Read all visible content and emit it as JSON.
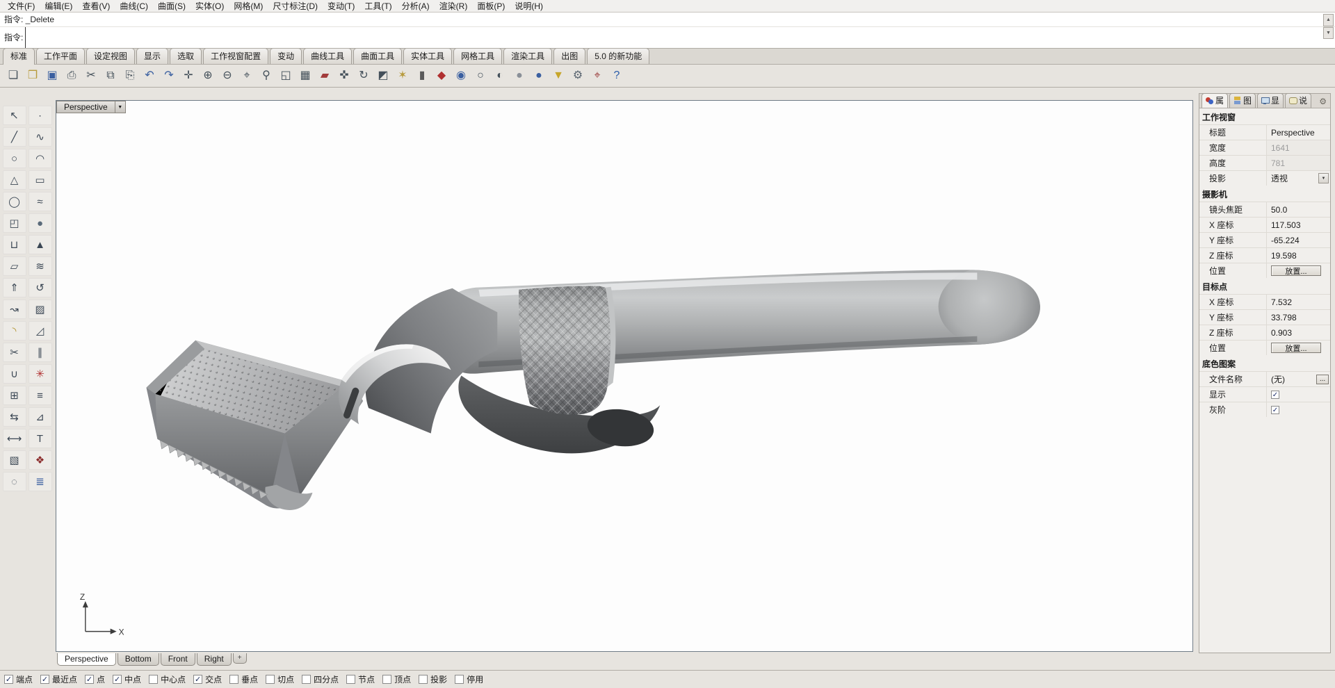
{
  "menu_bar": {
    "items": [
      {
        "name": "menu-file",
        "label": "文件(F)"
      },
      {
        "name": "menu-edit",
        "label": "编辑(E)"
      },
      {
        "name": "menu-view",
        "label": "查看(V)"
      },
      {
        "name": "menu-curve",
        "label": "曲线(C)"
      },
      {
        "name": "menu-surface",
        "label": "曲面(S)"
      },
      {
        "name": "menu-solid",
        "label": "实体(O)"
      },
      {
        "name": "menu-mesh",
        "label": "网格(M)"
      },
      {
        "name": "menu-dimension",
        "label": "尺寸标注(D)"
      },
      {
        "name": "menu-transform",
        "label": "变动(T)"
      },
      {
        "name": "menu-tools",
        "label": "工具(T)"
      },
      {
        "name": "menu-analyze",
        "label": "分析(A)"
      },
      {
        "name": "menu-render",
        "label": "渲染(R)"
      },
      {
        "name": "menu-panels",
        "label": "面板(P)"
      },
      {
        "name": "menu-help",
        "label": "说明(H)"
      }
    ]
  },
  "command": {
    "history": "指令: _Delete",
    "prompt_label": "指令:"
  },
  "toolbar_tabs": {
    "items": [
      {
        "name": "tab-standard",
        "label": "标准",
        "active": true
      },
      {
        "name": "tab-cplane",
        "label": "工作平面"
      },
      {
        "name": "tab-set-view",
        "label": "设定视图"
      },
      {
        "name": "tab-display",
        "label": "显示"
      },
      {
        "name": "tab-select",
        "label": "选取"
      },
      {
        "name": "tab-viewport-layout",
        "label": "工作视窗配置"
      },
      {
        "name": "tab-transform",
        "label": "变动"
      },
      {
        "name": "tab-curve-tools",
        "label": "曲线工具"
      },
      {
        "name": "tab-surface-tools",
        "label": "曲面工具"
      },
      {
        "name": "tab-solid-tools",
        "label": "实体工具"
      },
      {
        "name": "tab-mesh-tools",
        "label": "网格工具"
      },
      {
        "name": "tab-render-tools",
        "label": "渲染工具"
      },
      {
        "name": "tab-drafting",
        "label": "出图"
      },
      {
        "name": "tab-new-in-v5",
        "label": "5.0 的新功能"
      }
    ]
  },
  "toolbar": {
    "icons": [
      {
        "name": "new-document-icon",
        "glyph": "❏",
        "color": "#44505a"
      },
      {
        "name": "open-folder-icon",
        "glyph": "❒",
        "color": "#b79a3c"
      },
      {
        "name": "save-icon",
        "glyph": "▣",
        "color": "#3a5fa0"
      },
      {
        "name": "print-icon",
        "glyph": "⎙",
        "color": "#44505a"
      },
      {
        "name": "cut-icon",
        "glyph": "✂",
        "color": "#44505a"
      },
      {
        "name": "copy-icon",
        "glyph": "⧉",
        "color": "#44505a"
      },
      {
        "name": "paste-icon",
        "glyph": "⎘",
        "color": "#44505a"
      },
      {
        "name": "undo-icon",
        "glyph": "↶",
        "color": "#3a5fa0"
      },
      {
        "name": "redo-icon",
        "glyph": "↷",
        "color": "#3a5fa0"
      },
      {
        "name": "move-icon",
        "glyph": "✛",
        "color": "#44505a"
      },
      {
        "name": "zoom-in-icon",
        "glyph": "⊕",
        "color": "#44505a"
      },
      {
        "name": "zoom-out-icon",
        "glyph": "⊖",
        "color": "#44505a"
      },
      {
        "name": "zoom-window-icon",
        "glyph": "⌖",
        "color": "#44505a"
      },
      {
        "name": "zoom-dynamic-icon",
        "glyph": "⚲",
        "color": "#44505a"
      },
      {
        "name": "zoom-extents-icon",
        "glyph": "◱",
        "color": "#44505a"
      },
      {
        "name": "grid-snap-icon",
        "glyph": "▦",
        "color": "#44505a"
      },
      {
        "name": "eraser-icon",
        "glyph": "▰",
        "color": "#a23b3b"
      },
      {
        "name": "pan-icon",
        "glyph": "✜",
        "color": "#44505a"
      },
      {
        "name": "rotate-view-icon",
        "glyph": "↻",
        "color": "#44505a"
      },
      {
        "name": "shade-icon",
        "glyph": "◩",
        "color": "#44505a"
      },
      {
        "name": "lamp-icon",
        "glyph": "✶",
        "color": "#b79a3c"
      },
      {
        "name": "lock-icon",
        "glyph": "▮",
        "color": "#5a5a5a"
      },
      {
        "name": "render-icon",
        "glyph": "◆",
        "color": "#b03030"
      },
      {
        "name": "render-preview-icon",
        "glyph": "◉",
        "color": "#3a5fa0"
      },
      {
        "name": "wireframe-mode-icon",
        "glyph": "○",
        "color": "#44505a"
      },
      {
        "name": "shaded-mode-icon",
        "glyph": "◐",
        "color": "#44505a"
      },
      {
        "name": "ghosted-mode-icon",
        "glyph": "●",
        "color": "#8a9098"
      },
      {
        "name": "rendered-mode-icon",
        "glyph": "●",
        "color": "#3a5fa0"
      },
      {
        "name": "filter-icon",
        "glyph": "▼",
        "color": "#c7a62a"
      },
      {
        "name": "options-gear-icon",
        "glyph": "⚙",
        "color": "#5a6570"
      },
      {
        "name": "cplane-axis-icon",
        "glyph": "⌖",
        "color": "#9a3b3b"
      },
      {
        "name": "help-icon",
        "glyph": "?",
        "color": "#2a5caa"
      }
    ]
  },
  "left_palette": {
    "icons": [
      {
        "name": "select-arrow-icon",
        "glyph": "↖",
        "color": "#3b4754"
      },
      {
        "name": "point-icon",
        "glyph": "∙",
        "color": "#3b4754"
      },
      {
        "name": "polyline-icon",
        "glyph": "╱",
        "color": "#3b4754"
      },
      {
        "name": "curve-icon",
        "glyph": "∿",
        "color": "#3b4754"
      },
      {
        "name": "circle-icon",
        "glyph": "○",
        "color": "#3b4754"
      },
      {
        "name": "arc-icon",
        "glyph": "◠",
        "color": "#3b4754"
      },
      {
        "name": "polygon-icon",
        "glyph": "△",
        "color": "#3b4754"
      },
      {
        "name": "rectangle-icon",
        "glyph": "▭",
        "color": "#3b4754"
      },
      {
        "name": "ellipse-icon",
        "glyph": "◯",
        "color": "#3b4754"
      },
      {
        "name": "helix-icon",
        "glyph": "≈",
        "color": "#3b4754"
      },
      {
        "name": "box-icon",
        "glyph": "◰",
        "color": "#3b4754"
      },
      {
        "name": "sphere-icon",
        "glyph": "●",
        "color": "#5a6a7a"
      },
      {
        "name": "cylinder-icon",
        "glyph": "⊔",
        "color": "#3b4754"
      },
      {
        "name": "cone-icon",
        "glyph": "▲",
        "color": "#3b4754"
      },
      {
        "name": "plane-icon",
        "glyph": "▱",
        "color": "#3b4754"
      },
      {
        "name": "loft-icon",
        "glyph": "≋",
        "color": "#3b4754"
      },
      {
        "name": "extrude-icon",
        "glyph": "⇑",
        "color": "#3b4754"
      },
      {
        "name": "revolve-icon",
        "glyph": "↺",
        "color": "#3b4754"
      },
      {
        "name": "sweep-icon",
        "glyph": "↝",
        "color": "#3b4754"
      },
      {
        "name": "patch-icon",
        "glyph": "▨",
        "color": "#3b4754"
      },
      {
        "name": "fillet-icon",
        "glyph": "◝",
        "color": "#b0922a"
      },
      {
        "name": "chamfer-icon",
        "glyph": "◿",
        "color": "#3b4754"
      },
      {
        "name": "trim-icon",
        "glyph": "✂",
        "color": "#3b4754"
      },
      {
        "name": "split-icon",
        "glyph": "∥",
        "color": "#3b4754"
      },
      {
        "name": "join-icon",
        "glyph": "∪",
        "color": "#3b4754"
      },
      {
        "name": "explode-icon",
        "glyph": "✳",
        "color": "#b03030"
      },
      {
        "name": "array-icon",
        "glyph": "⊞",
        "color": "#3b4754"
      },
      {
        "name": "offset-icon",
        "glyph": "≡",
        "color": "#3b4754"
      },
      {
        "name": "mirror-icon",
        "glyph": "⇆",
        "color": "#3b4754"
      },
      {
        "name": "scale-icon",
        "glyph": "⊿",
        "color": "#3b4754"
      },
      {
        "name": "dimension-icon",
        "glyph": "⟷",
        "color": "#3b4754"
      },
      {
        "name": "text-tool-icon",
        "glyph": "T",
        "color": "#3b4754"
      },
      {
        "name": "hatch-icon",
        "glyph": "▧",
        "color": "#3b4754"
      },
      {
        "name": "block-icon",
        "glyph": "❖",
        "color": "#8a2a2a"
      },
      {
        "name": "hide-object-icon",
        "glyph": "◌",
        "color": "#3b4754"
      },
      {
        "name": "layer-tool-icon",
        "glyph": "≣",
        "color": "#3a5fa0"
      }
    ]
  },
  "viewport": {
    "title": "Perspective",
    "axis_z": "Z",
    "axis_x": "X"
  },
  "viewport_tabs": {
    "items": [
      {
        "name": "vtab-perspective",
        "label": "Perspective",
        "active": true
      },
      {
        "name": "vtab-bottom",
        "label": "Bottom"
      },
      {
        "name": "vtab-front",
        "label": "Front"
      },
      {
        "name": "vtab-right",
        "label": "Right"
      },
      {
        "name": "vtab-new-viewport",
        "label": "+",
        "mini": true
      }
    ]
  },
  "osnap": {
    "items": [
      {
        "name": "osnap-end",
        "label": "端点",
        "checked": true
      },
      {
        "name": "osnap-near",
        "label": "最近点",
        "checked": true
      },
      {
        "name": "osnap-point",
        "label": "点",
        "checked": true
      },
      {
        "name": "osnap-mid",
        "label": "中点",
        "checked": true
      },
      {
        "name": "osnap-center",
        "label": "中心点",
        "checked": false
      },
      {
        "name": "osnap-intersection",
        "label": "交点",
        "checked": true
      },
      {
        "name": "osnap-perpendicular",
        "label": "垂点",
        "checked": false
      },
      {
        "name": "osnap-tangent",
        "label": "切点",
        "checked": false
      },
      {
        "name": "osnap-quadrant",
        "label": "四分点",
        "checked": false
      },
      {
        "name": "osnap-knot",
        "label": "节点",
        "checked": false
      },
      {
        "name": "osnap-vertex",
        "label": "顶点",
        "checked": false
      },
      {
        "name": "osnap-project",
        "label": "投影",
        "checked": false
      },
      {
        "name": "osnap-disable",
        "label": "停用",
        "checked": false
      }
    ]
  },
  "properties_panel": {
    "tabs": [
      {
        "label": "属"
      },
      {
        "label": "图"
      },
      {
        "label": "显"
      },
      {
        "label": "说"
      }
    ],
    "gear_glyph": "⚙",
    "viewport_section": {
      "title": "工作视窗",
      "title_label": "标题",
      "title_value": "Perspective",
      "width_label": "宽度",
      "width_value": "1641",
      "height_label": "高度",
      "height_value": "781",
      "projection_label": "投影",
      "projection_value": "透视"
    },
    "camera_section": {
      "title": "摄影机",
      "lens_label": "镜头焦距",
      "lens_value": "50.0",
      "x_label": "X 座标",
      "x_value": "117.503",
      "y_label": "Y 座标",
      "y_value": "-65.224",
      "z_label": "Z 座标",
      "z_value": "19.598",
      "place_label": "位置",
      "place_button": "放置..."
    },
    "target_section": {
      "title": "目标点",
      "x_label": "X 座标",
      "x_value": "7.532",
      "y_label": "Y 座标",
      "y_value": "33.798",
      "z_label": "Z 座标",
      "z_value": "0.903",
      "place_label": "位置",
      "place_button": "放置..."
    },
    "wallpaper_section": {
      "title": "底色图案",
      "filename_label": "文件名称",
      "filename_value": "(无)",
      "browse_button": "...",
      "show_label": "显示",
      "show_checked": true,
      "gray_label": "灰阶",
      "gray_checked": true
    }
  },
  "colors": {
    "chrome": "#e7e4df",
    "viewport_bg": "#fdfdfd",
    "panel_bg": "#f1efec",
    "model_gray": "#9a9c9e"
  }
}
